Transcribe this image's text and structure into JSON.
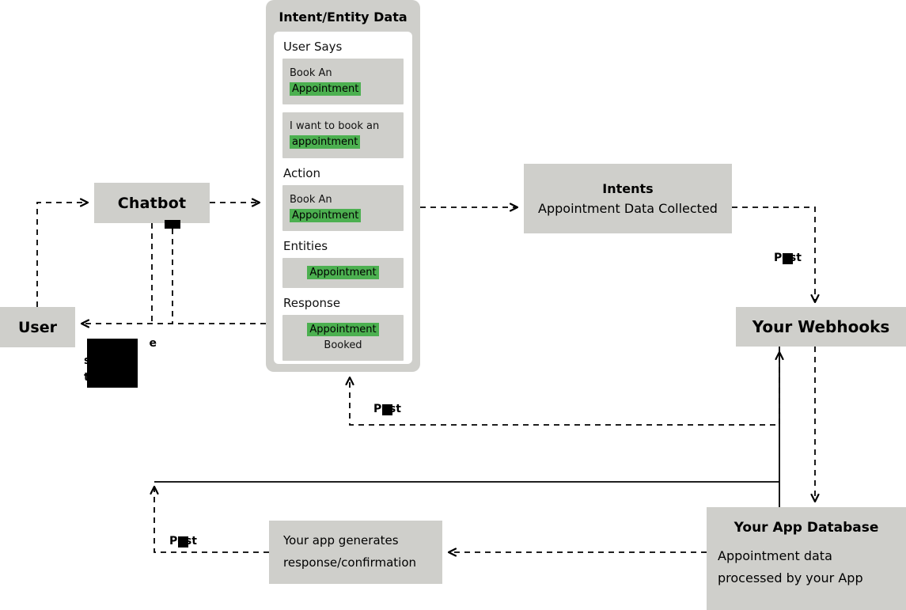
{
  "diagram": {
    "title_visible": false,
    "colors": {
      "node_fill": "#cfcfcb",
      "highlight_green": "#4cb050",
      "line": "#000000",
      "panel_inner": "#ffffff",
      "redaction": "#000000"
    },
    "nodes": {
      "chatbot": {
        "title": "Chatbot"
      },
      "user": {
        "title": "User"
      },
      "intents": {
        "title": "Intents",
        "subtitle": "Appointment Data Collected"
      },
      "webhooks": {
        "title": "Your Webhooks"
      },
      "app_database": {
        "title": "Your App Database",
        "subtitle": "Appointment data processed by your App"
      },
      "app_generates": {
        "line1": "Your app generates",
        "line2": "response/confirmation"
      }
    },
    "intent_panel": {
      "title": "Intent/Entity Data",
      "sections": [
        {
          "label": "User Says",
          "items": [
            {
              "pre": "Book An ",
              "highlight": "Appointment",
              "post": ""
            },
            {
              "pre": "I want to book an",
              "highlight": "appointment",
              "post": "",
              "two_line": true
            }
          ]
        },
        {
          "label": "Action",
          "items": [
            {
              "pre": "Book An ",
              "highlight": "Appointment",
              "post": ""
            }
          ]
        },
        {
          "label": "Entities",
          "items": [
            {
              "pre": "",
              "highlight": "Appointment",
              "post": "",
              "center": true
            }
          ]
        },
        {
          "label": "Response",
          "items": [
            {
              "pre": "",
              "highlight": "Appointment",
              "post": " Booked"
            }
          ]
        }
      ]
    },
    "edge_labels": {
      "post_webhooks_to_intents": "Post",
      "post_to_intent_panel": "Post",
      "post_bottom_left": "Post"
    },
    "redactions": {
      "note_partial_lines": [
        "e",
        "s",
        "t"
      ],
      "count": 6
    }
  }
}
